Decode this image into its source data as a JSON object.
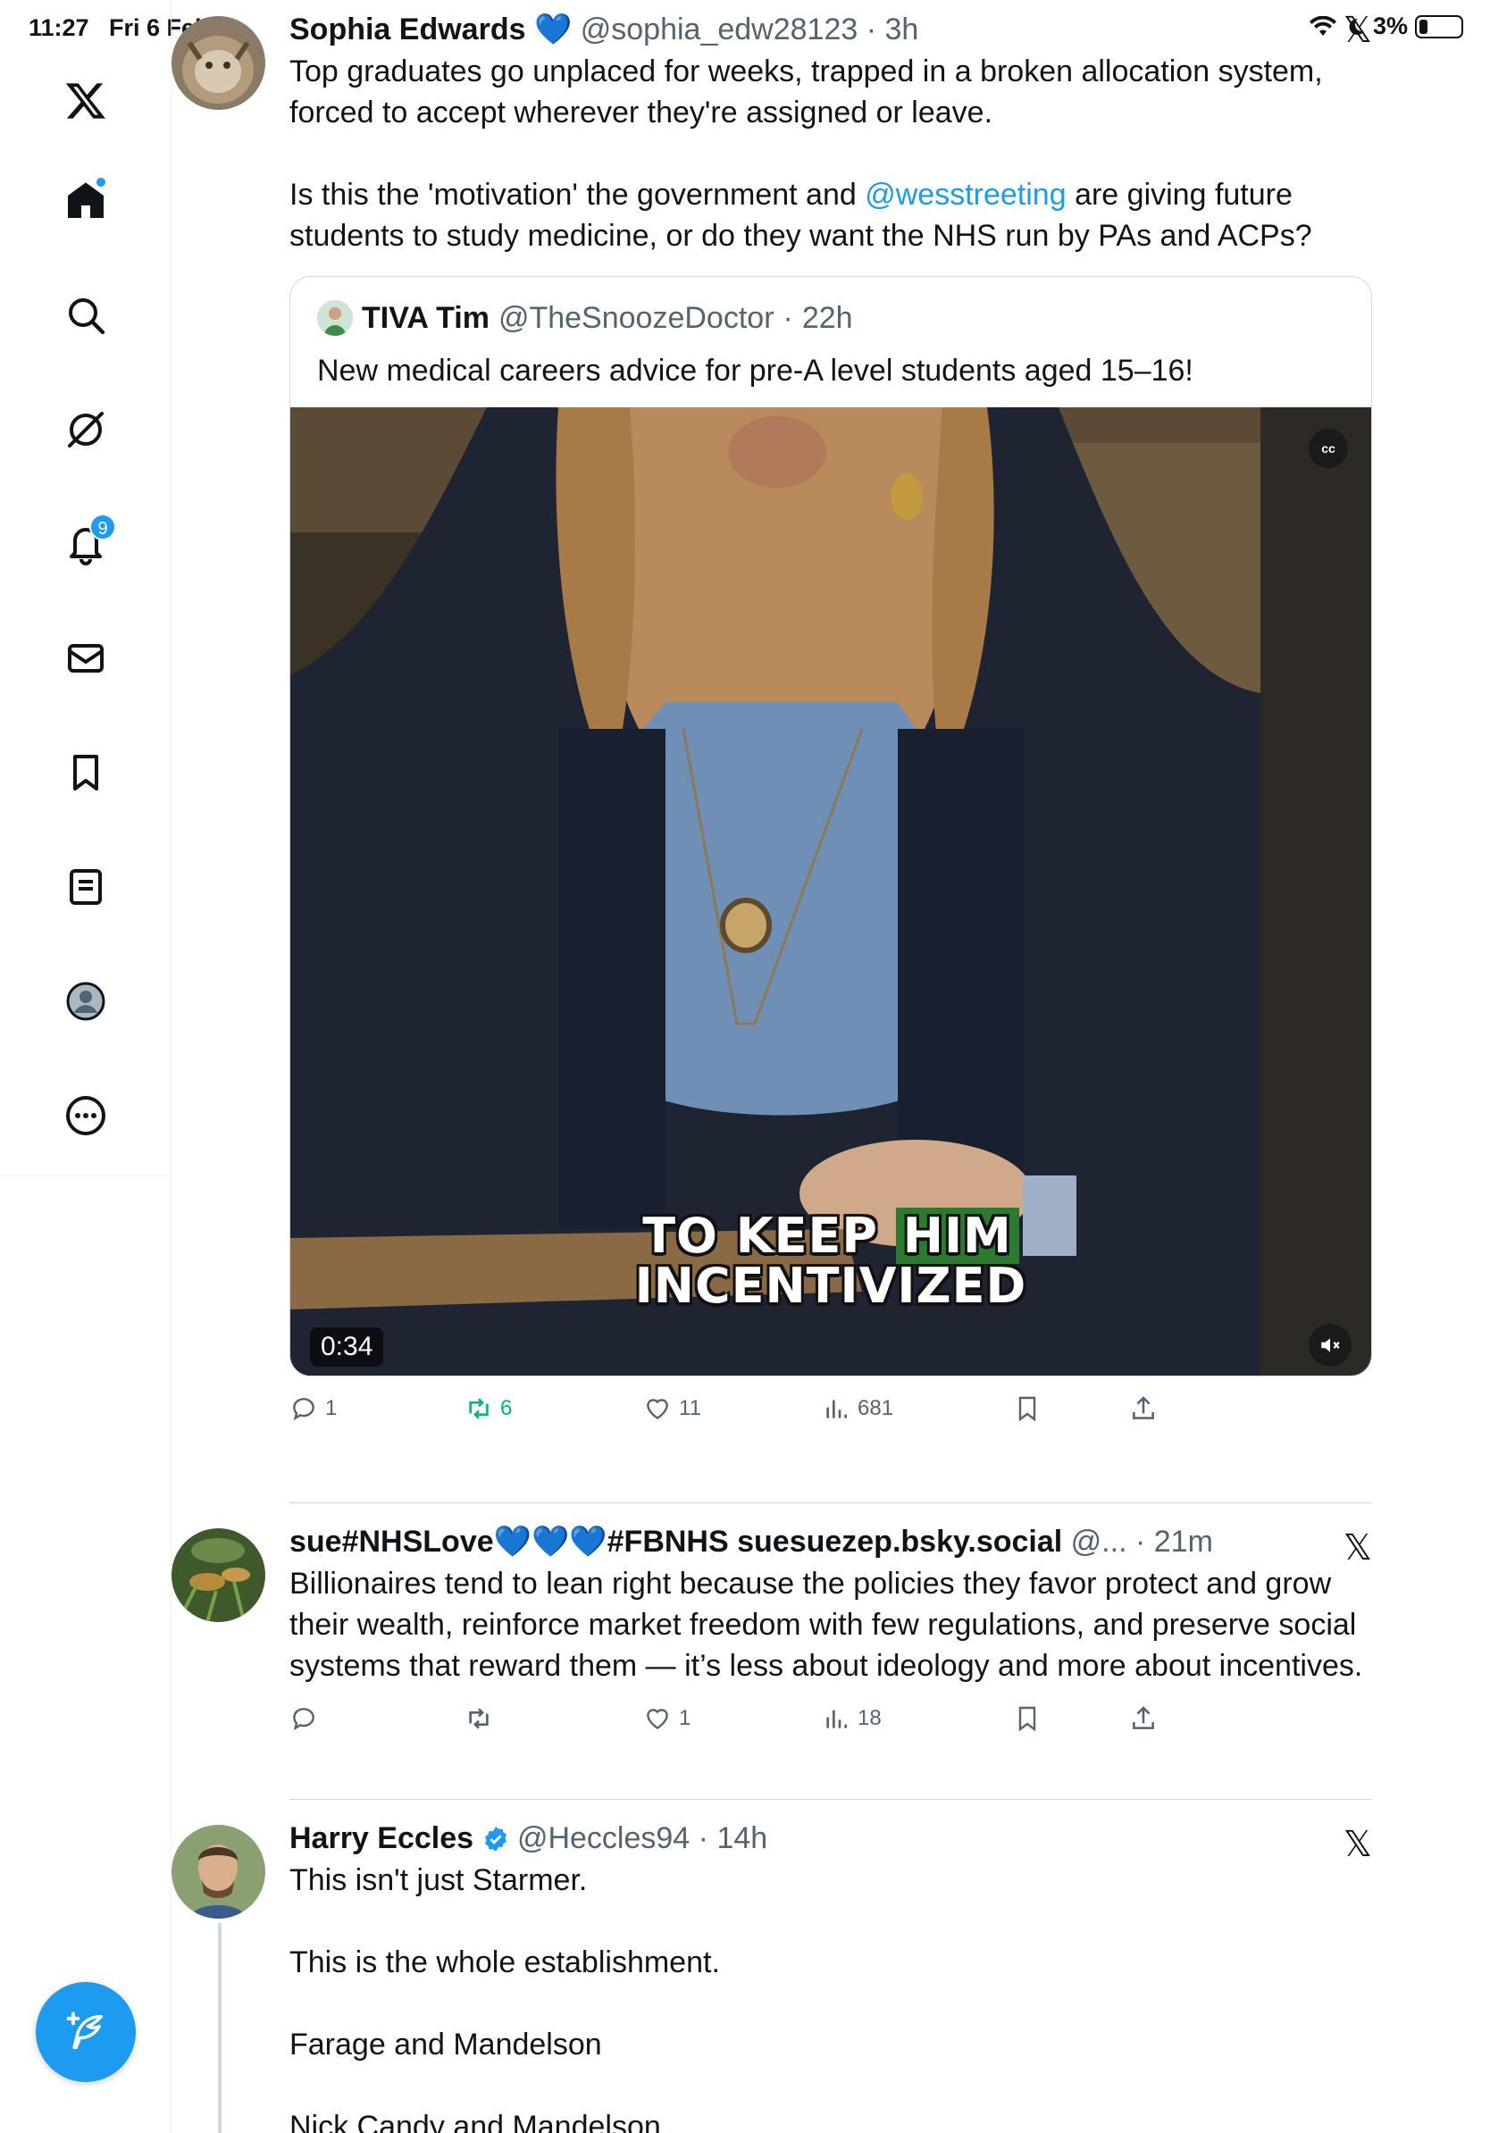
{
  "status": {
    "time": "11:27",
    "date": "Fri 6 Feb",
    "battery": "3%"
  },
  "nav": {
    "notifications_badge": "9"
  },
  "tweets": [
    {
      "name": "Sophia Edwards",
      "name_suffix": " 💙 ",
      "handle": "@sophia_edw28123",
      "time": "3h",
      "text_1": "Top graduates go unplaced for weeks, trapped in a broken allocation system, forced to accept wherever they're assigned or leave.\n\nIs this the 'motivation' the government and ",
      "mention": "@wesstreeting",
      "text_2": " are giving future students to study medicine, or do they want the NHS run by PAs and ACPs?",
      "quote": {
        "name": "TIVA Tim",
        "handle": "@TheSnoozeDoctor",
        "time": "22h",
        "text": "New medical careers advice for pre-A level students aged 15–16!",
        "video_caption_1a": "TO KEEP ",
        "video_caption_1b": "HIM",
        "video_caption_2": "INCENTIVIZED",
        "video_duration": "0:34",
        "cc": "cc"
      },
      "replies": "1",
      "reposts": "6",
      "likes": "11",
      "views": "681"
    },
    {
      "name": "sue#NHSLove💙💙💙#FBNHS suesuezep.bsky.social",
      "handle": "@...",
      "time": "21m",
      "text": "Billionaires tend to lean right because the policies they favor protect and grow their wealth, reinforce market freedom with few regulations, and preserve social systems that reward them — it’s less about ideology and more about incentives.",
      "replies": "",
      "reposts": "",
      "likes": "1",
      "views": "18"
    },
    {
      "name": "Harry Eccles",
      "handle": "@Heccles94",
      "time": "14h",
      "text": "This isn't just Starmer.\n\nThis is the whole establishment.\n\nFarage and Mandelson\n\nNick Candy and Mandelson"
    }
  ],
  "colors": {
    "accent": "#1d9bf0",
    "repost_green": "#00ba7c",
    "muted": "#536471"
  }
}
